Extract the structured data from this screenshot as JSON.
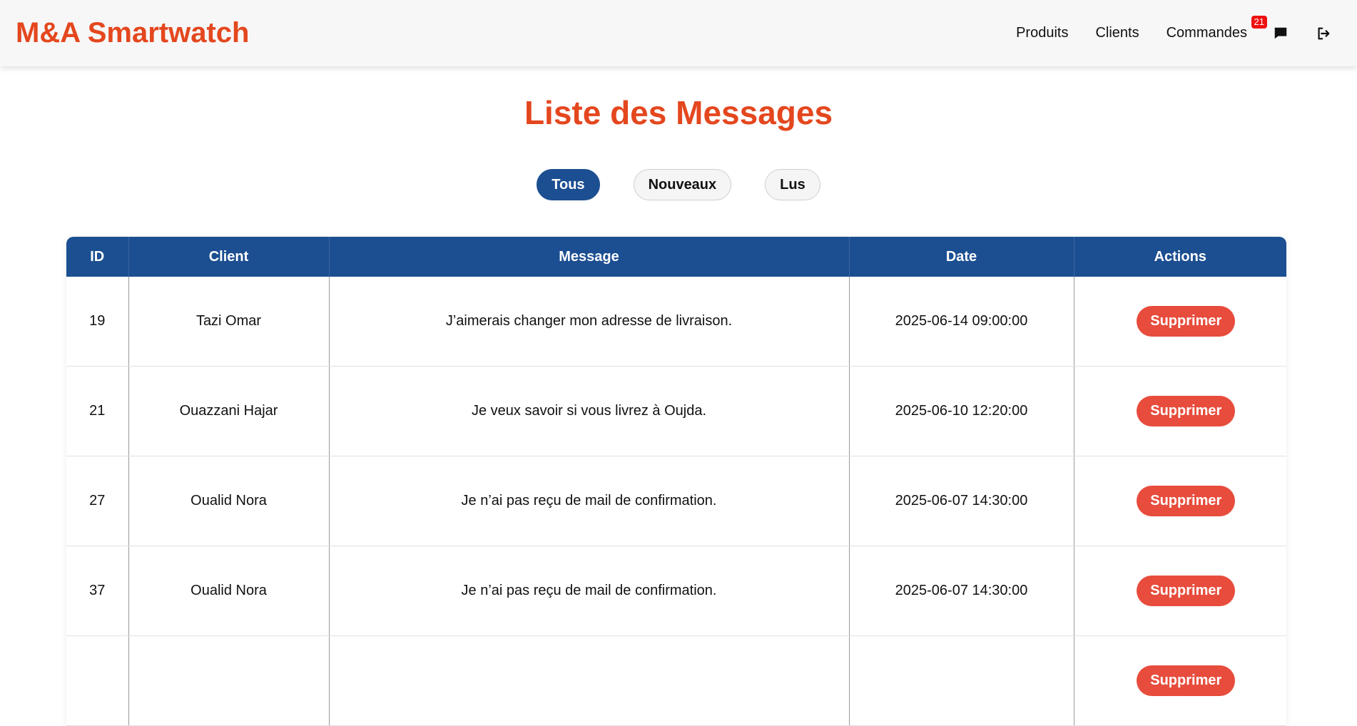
{
  "navbar": {
    "brand": "M&A Smartwatch",
    "links": [
      {
        "label": "Produits"
      },
      {
        "label": "Clients"
      },
      {
        "label": "Commandes",
        "badge": "21"
      }
    ],
    "icons": [
      "message-icon",
      "logout-icon"
    ],
    "badge_color": "#ee1111"
  },
  "page": {
    "title": "Liste des Messages"
  },
  "filters": [
    {
      "label": "Tous",
      "active": true
    },
    {
      "label": "Nouveaux",
      "active": false
    },
    {
      "label": "Lus",
      "active": false
    }
  ],
  "table": {
    "headers": [
      "ID",
      "Client",
      "Message",
      "Date",
      "Actions"
    ],
    "rows": [
      {
        "id": "19",
        "client": "Tazi Omar",
        "message": "J’aimerais changer mon adresse de livraison.",
        "date": "2025-06-14 09:00:00",
        "action": "Supprimer"
      },
      {
        "id": "21",
        "client": "Ouazzani Hajar",
        "message": "Je veux savoir si vous livrez à Oujda.",
        "date": "2025-06-10 12:20:00",
        "action": "Supprimer"
      },
      {
        "id": "27",
        "client": "Oualid Nora",
        "message": "Je n’ai pas reçu de mail de confirmation.",
        "date": "2025-06-07 14:30:00",
        "action": "Supprimer"
      },
      {
        "id": "37",
        "client": "Oualid Nora",
        "message": "Je n’ai pas reçu de mail de confirmation.",
        "date": "2025-06-07 14:30:00",
        "action": "Supprimer"
      },
      {
        "id": "",
        "client": "",
        "message": "",
        "date": "",
        "action": "Supprimer"
      }
    ]
  },
  "colors": {
    "brand": "#e4471e",
    "header_blue": "#1c4f91",
    "delete_red": "#e74c3c"
  }
}
